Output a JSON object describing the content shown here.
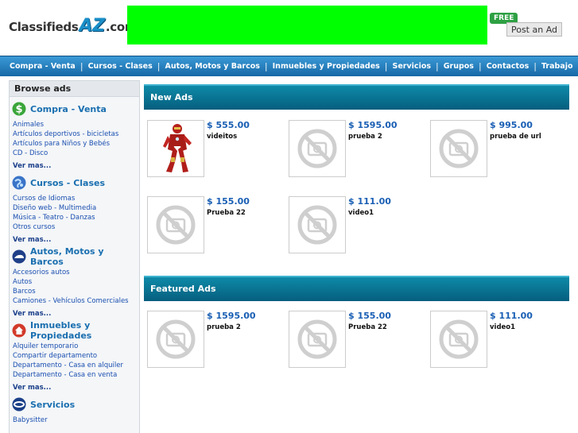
{
  "header": {
    "logo_prefix": "Classifieds",
    "logo_az": "AZ",
    "logo_suffix": ".com",
    "free_badge": "FREE",
    "post_ad": "Post an Ad",
    "banner_color": "#00ff00"
  },
  "nav": {
    "items": [
      "Compra - Venta",
      "Cursos - Clases",
      "Autos, Motos y Barcos",
      "Inmuebles y Propiedades",
      "Servicios",
      "Grupos",
      "Contactos",
      "Trabajo"
    ]
  },
  "sidebar": {
    "title": "Browse ads",
    "categories": [
      {
        "title": "Compra - Venta",
        "icon": "dollar-icon",
        "links": [
          "Animales",
          "Artículos deportivos - bicicletas",
          "Artículos para Niños y Bebés",
          "CD - Disco"
        ],
        "more": "Ver mas..."
      },
      {
        "title": "Cursos - Clases",
        "icon": "globe-icon",
        "links": [
          "Cursos de Idiomas",
          "Diseño web - Multimedia",
          "Música - Teatro - Danzas",
          "Otros cursos"
        ],
        "more": "Ver mas..."
      },
      {
        "title": "Autos, Motos y Barcos",
        "icon": "car-icon",
        "links": [
          "Accesorios autos",
          "Autos",
          "Barcos",
          "Camiones - Vehículos Comerciales"
        ],
        "more": "Ver mas..."
      },
      {
        "title": "Inmuebles y Propiedades",
        "icon": "house-icon",
        "links": [
          "Alquiler temporario",
          "Compartir departamento",
          "Departamento - Casa en alquiler",
          "Departamento - Casa en venta"
        ],
        "more": "Ver mas..."
      },
      {
        "title": "Servicios",
        "icon": "services-icon",
        "links": [
          "Babysitter"
        ],
        "more": ""
      }
    ]
  },
  "new_ads": {
    "title": "New Ads",
    "items": [
      {
        "price": "$ 555.00",
        "title": "videitos",
        "image": "ironman-figure"
      },
      {
        "price": "$ 1595.00",
        "title": "prueba 2",
        "image": "no-photo-icon"
      },
      {
        "price": "$ 995.00",
        "title": "prueba de url",
        "image": "no-photo-icon"
      },
      {
        "price": "$ 155.00",
        "title": "Prueba 22",
        "image": "no-photo-icon"
      },
      {
        "price": "$ 111.00",
        "title": "video1",
        "image": "no-photo-icon"
      }
    ]
  },
  "featured_ads": {
    "title": "Featured Ads",
    "items": [
      {
        "price": "$ 1595.00",
        "title": "prueba 2",
        "image": "no-photo-icon"
      },
      {
        "price": "$ 155.00",
        "title": "Prueba 22",
        "image": "no-photo-icon"
      },
      {
        "price": "$ 111.00",
        "title": "video1",
        "image": "no-photo-icon"
      }
    ]
  }
}
